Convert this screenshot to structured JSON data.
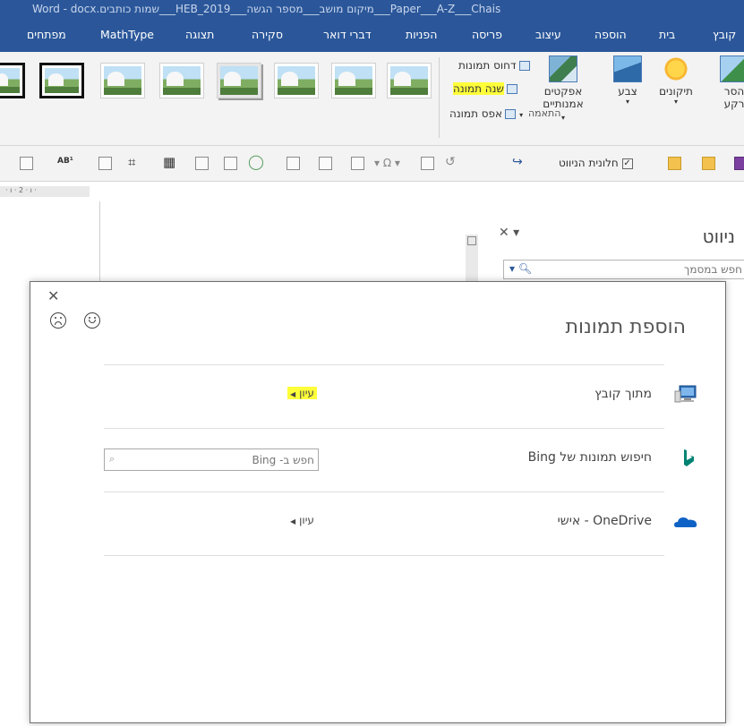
{
  "window": {
    "title": "Word - docx.שמות כותבים___HEB_2019___מיקום מושב___מספר הגשה___Paper___A-Z___Chais"
  },
  "ribbon_tabs": [
    {
      "label": "קובץ"
    },
    {
      "label": "בית"
    },
    {
      "label": "הוספה"
    },
    {
      "label": "עיצוב"
    },
    {
      "label": "פריסה"
    },
    {
      "label": "הפניות"
    },
    {
      "label": "דברי דואר"
    },
    {
      "label": "סקירה"
    },
    {
      "label": "תצוגה"
    },
    {
      "label": "MathType"
    },
    {
      "label": "מפתחים"
    }
  ],
  "ribbon": {
    "remove_bg_line1": "הסר",
    "remove_bg_line2": "רקע",
    "corrections": "תיקונים",
    "color": "צבע",
    "artistic_line1": "אפקטים",
    "artistic_line2": "אמנותיים",
    "compress": "דחוס תמונות",
    "change": "שנה תמונה",
    "reset": "אפס תמונה",
    "group_adjust": "התאמה"
  },
  "toolbar": {
    "nav_pane_label": "חלונית הניווט",
    "nav_pane_checked": true
  },
  "nav_pane": {
    "title": "ניווט",
    "search_placeholder": "חפש במסמך"
  },
  "ruler": {
    "marks": "· ı · 2 · ı ·"
  },
  "dialog": {
    "title": "הוספת תמונות",
    "sources": [
      {
        "label": "מתוך קובץ",
        "action": "עיון",
        "highlighted": true
      },
      {
        "label": "חיפוש תמונות של Bing",
        "search_placeholder": "חפש ב- Bing"
      },
      {
        "label": "OneDrive - אישי",
        "action": "עיון",
        "highlighted": false
      }
    ]
  },
  "colors": {
    "titlebar": "#2b579a",
    "highlight": "#ffff3a",
    "bing": "#008373",
    "onedrive": "#0f62c5"
  }
}
